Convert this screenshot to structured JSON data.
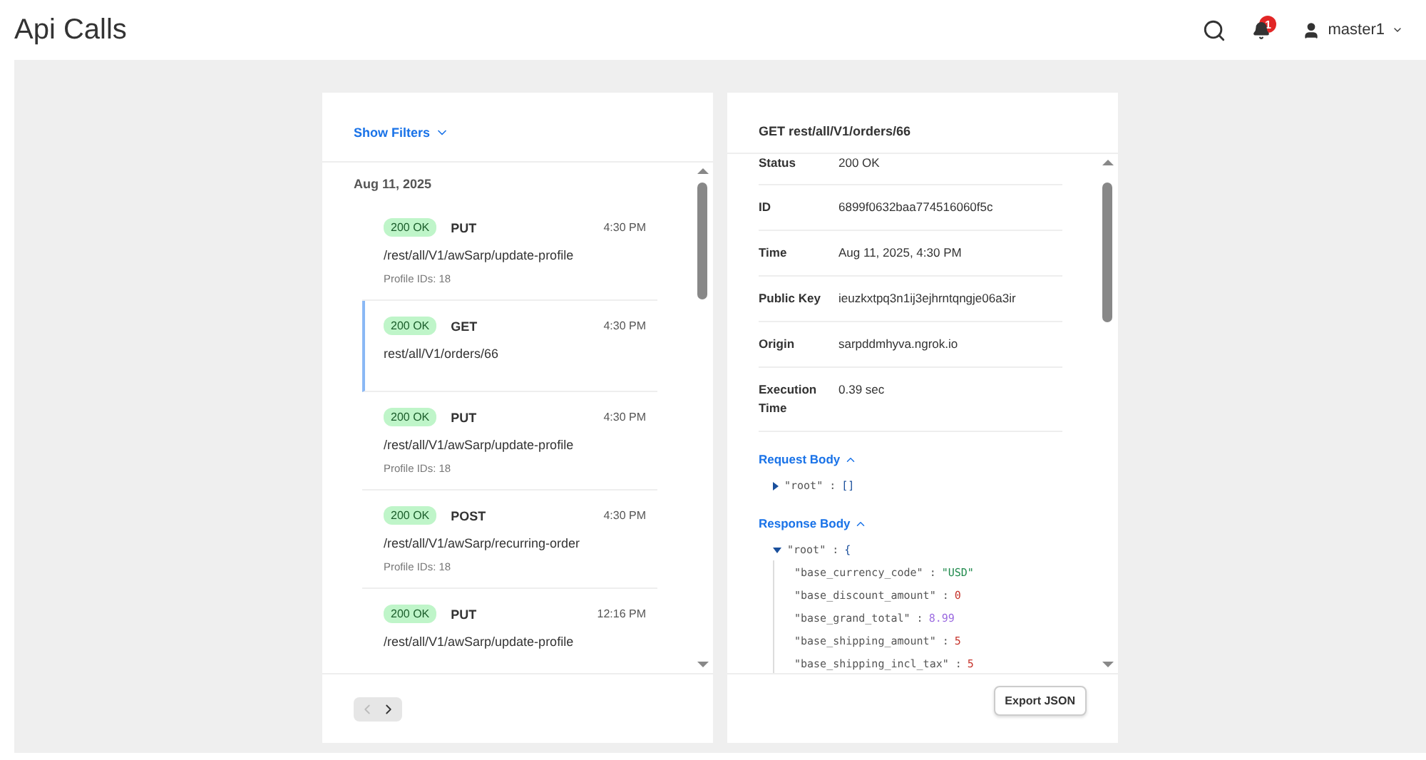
{
  "page_title": "Api Calls",
  "header": {
    "notification_count": "1",
    "user": "master1"
  },
  "list_panel": {
    "filter_toggle": "Show Filters",
    "date": "Aug 11, 2025",
    "calls": [
      {
        "status": "200 OK",
        "method": "PUT",
        "time": "4:30 PM",
        "path": "/rest/all/V1/awSarp/update-profile",
        "meta": "Profile IDs: 18",
        "selected": false
      },
      {
        "status": "200 OK",
        "method": "GET",
        "time": "4:30 PM",
        "path": "rest/all/V1/orders/66",
        "selected": true
      },
      {
        "status": "200 OK",
        "method": "PUT",
        "time": "4:30 PM",
        "path": "/rest/all/V1/awSarp/update-profile",
        "meta": "Profile IDs: 18",
        "selected": false
      },
      {
        "status": "200 OK",
        "method": "POST",
        "time": "4:30 PM",
        "path": "/rest/all/V1/awSarp/recurring-order",
        "meta": "Profile IDs: 18",
        "selected": false
      },
      {
        "status": "200 OK",
        "method": "PUT",
        "time": "12:16 PM",
        "path": "/rest/all/V1/awSarp/update-profile",
        "selected": false
      }
    ],
    "pager": {
      "prev_disabled": true
    }
  },
  "detail_panel": {
    "title": "GET rest/all/V1/orders/66",
    "fields": [
      {
        "label": "Status",
        "value": "200 OK"
      },
      {
        "label": "ID",
        "value": "6899f0632baa774516060f5c"
      },
      {
        "label": "Time",
        "value": "Aug 11, 2025, 4:30 PM"
      },
      {
        "label": "Public Key",
        "value": "ieuzkxtpq3n1ij3ejhrntqngje06a3ir"
      },
      {
        "label": "Origin",
        "value": "sarpddmhyva.ngrok.io"
      },
      {
        "label": "Execution Time",
        "value": "0.39 sec"
      }
    ],
    "request_body": {
      "label": "Request Body",
      "expanded": true,
      "root_key": "\"root\" :",
      "root_value": "[]",
      "root_expanded": false
    },
    "response_body": {
      "label": "Response Body",
      "expanded": true,
      "root_key": "\"root\" :",
      "root_value": "{",
      "root_expanded": true,
      "entries": [
        {
          "key": "\"base_currency_code\" :",
          "value": "\"USD\"",
          "kind": "string"
        },
        {
          "key": "\"base_discount_amount\" :",
          "value": "0",
          "kind": "integer"
        },
        {
          "key": "\"base_grand_total\" :",
          "value": "8.99",
          "kind": "float"
        },
        {
          "key": "\"base_shipping_amount\" :",
          "value": "5",
          "kind": "integer"
        },
        {
          "key": "\"base_shipping_incl_tax\" :",
          "value": "5",
          "kind": "integer"
        }
      ]
    },
    "export_button": "Export JSON"
  }
}
